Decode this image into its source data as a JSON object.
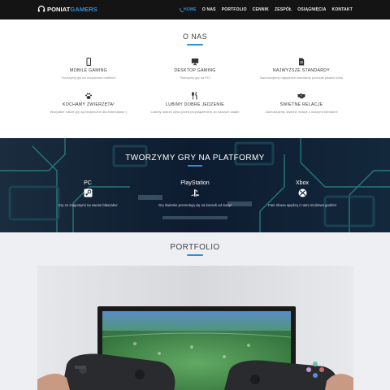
{
  "nav": {
    "logo_part1": "PONIAT",
    "logo_part2": "GAMERS",
    "items": [
      {
        "label": "HOME",
        "active": true
      },
      {
        "label": "O NAS"
      },
      {
        "label": "PORTFOLIO"
      },
      {
        "label": "CENNIK"
      },
      {
        "label": "ZESPÓŁ"
      },
      {
        "label": "OSIĄGNIĘCIA"
      },
      {
        "label": "KONTAKT"
      }
    ]
  },
  "about": {
    "title": "O NAS",
    "features": [
      {
        "icon": "mobile-icon",
        "title": "MOBILE GAMING",
        "desc": "Tworzymy gry na urządzenia mobilne!"
      },
      {
        "icon": "desktop-icon",
        "title": "DESKTOP GAMING",
        "desc": "Tworzymy gry na PC!"
      },
      {
        "icon": "document-icon",
        "title": "NAJWYŻSZE STANDARDY",
        "desc": "Zachowujemy najwyższe standardy podczas pisania kodu"
      },
      {
        "icon": "paw-icon",
        "title": "KOCHAMY ZWIERZĘTA!",
        "desc": "Wszystkie nasze gry są bezpieczne dla zwierzaków :)"
      },
      {
        "icon": "cutlery-icon",
        "title": "LUBIMY DOBRE JEDZENIE",
        "desc": "Lubimy dobrze zjeść przed przystąpieniem do naszych zadań"
      },
      {
        "icon": "handshake-icon",
        "title": "ŚWIETNE RELACJE",
        "desc": "Zachowujemy świetne relacje z naszymi klientami!"
      }
    ]
  },
  "platforms": {
    "title": "TWORZYMY GRY NA PLATFORMY",
    "items": [
      {
        "name": "PC",
        "icon": "steam-icon",
        "desc": "Gry ze znajomymi na swoim blaszaku!"
      },
      {
        "name": "PlayStation",
        "icon": "playstation-icon",
        "desc": "Gry świetnie prezentują się na konsoli od Sony!"
      },
      {
        "name": "Xbox",
        "icon": "xbox-icon",
        "desc": "Fani Xboxa spędzą z nami mnóstwo godzin!"
      }
    ]
  },
  "portfolio": {
    "title": "PORTFOLIO"
  },
  "colors": {
    "accent": "#2f8fd6",
    "navbar": "#141414",
    "platforms_bg": "#0e1a2b",
    "portfolio_bg": "#eeeff2"
  }
}
